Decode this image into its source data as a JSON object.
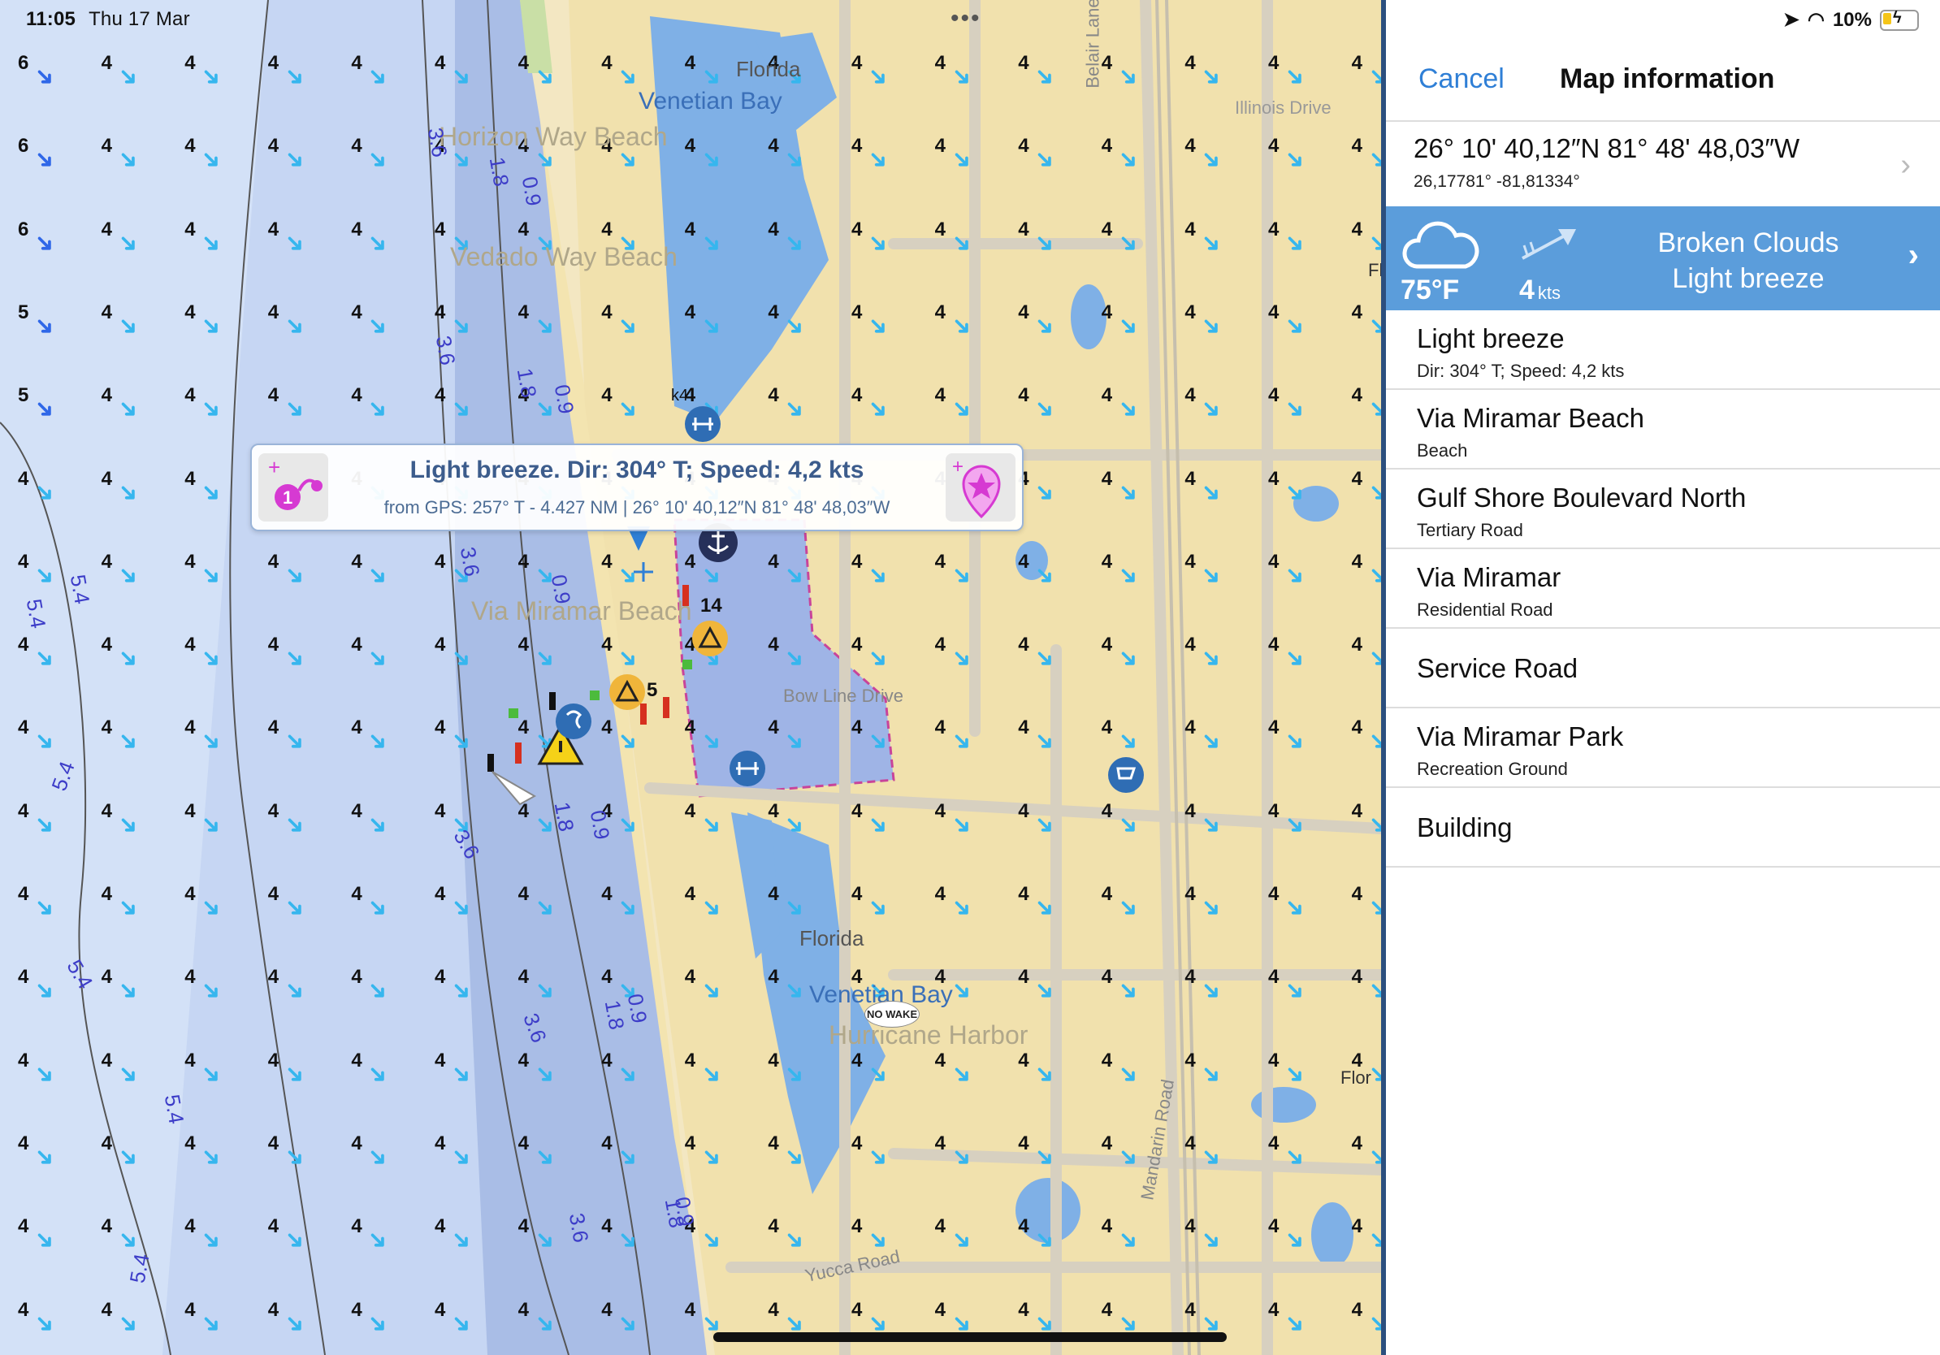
{
  "status": {
    "time": "11:05",
    "date": "Thu 17 Mar",
    "battery": "10%"
  },
  "map": {
    "labels": {
      "florida1": "Florida",
      "florida2": "Florida",
      "venetian_bay1": "Venetian Bay",
      "venetian_bay2": "Venetian Bay",
      "horizon_way_beach": "Horizon Way Beach",
      "vedado_way_beach": "Vedado Way Beach",
      "via_miramar_beach": "Via Miramar Beach",
      "bow_line_drive": "Bow Line Drive",
      "illinois_drive": "Illinois Drive",
      "hurricane_harbor": "Hurricane Harbor",
      "yucca_road": "Yucca Road",
      "mandarin_road": "Mandarin Road",
      "belair_lane": "Belair Lane",
      "no_wake": "NO WAKE",
      "fl": "Fl",
      "flor": "Flor",
      "marker_14": "14",
      "marker_5": "5",
      "marker_k4": "k4"
    },
    "depths": [
      "3.6",
      "1.8",
      "0.9",
      "3.6",
      "1.8",
      "0.9",
      "3.6",
      "0.9",
      "1.8",
      "5.4",
      "5.4",
      "3.6",
      "1.8",
      "0.9",
      "5.4",
      "3.6",
      "1.8",
      "5.4",
      "0.9",
      "5.4",
      "3.6",
      "1.8",
      "0.9",
      "5.4"
    ],
    "wind_strong_col": [
      "6",
      "6",
      "6",
      "5",
      "5"
    ],
    "wind_default": "4"
  },
  "popup": {
    "title": "Light breeze. Dir: 304° T; Speed: 4,2 kts",
    "subtitle": "from GPS: 257° T - 4.427 NM | 26° 10' 40,12″N   81° 48' 48,03″W"
  },
  "panel": {
    "cancel": "Cancel",
    "title": "Map information",
    "coords": {
      "dms": "26° 10' 40,12″N   81° 48' 48,03″W",
      "decimal": "26,17781° -81,81334°"
    },
    "weather": {
      "temp": "75°F",
      "speed": "4",
      "speed_unit": "kts",
      "desc1": "Broken Clouds",
      "desc2": "Light breeze"
    },
    "items": [
      {
        "title": "Light breeze",
        "subtitle": "Dir: 304° T; Speed: 4,2 kts"
      },
      {
        "title": "Via Miramar Beach",
        "subtitle": "Beach"
      },
      {
        "title": "Gulf Shore Boulevard North",
        "subtitle": "Tertiary Road"
      },
      {
        "title": "Via Miramar",
        "subtitle": "Residential Road"
      },
      {
        "title": "Service Road",
        "subtitle": ""
      },
      {
        "title": "Via Miramar Park",
        "subtitle": "Recreation Ground"
      },
      {
        "title": "Building",
        "subtitle": ""
      }
    ]
  }
}
